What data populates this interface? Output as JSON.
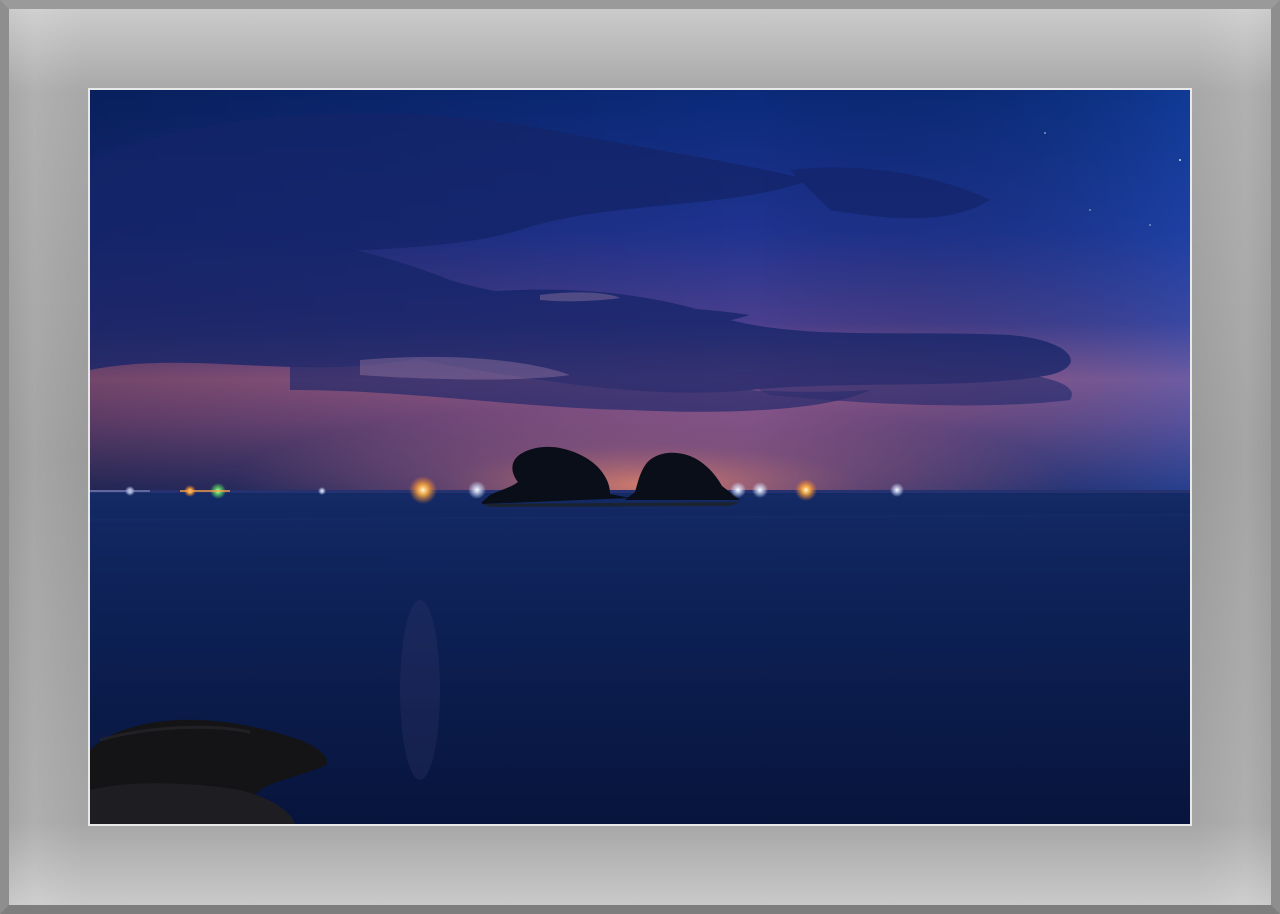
{
  "scene": {
    "subject": "two-small-islands-at-dusk",
    "sky_top_color": "#0a2a78",
    "sky_mid_color": "#2a3a8a",
    "sky_glow_color": "#b06a8e",
    "horizon_glow_color": "#e07a5a",
    "sea_color": "#0b1a4a",
    "frame_color": "#9b9b9b",
    "border_color": "#e8e8e8"
  }
}
